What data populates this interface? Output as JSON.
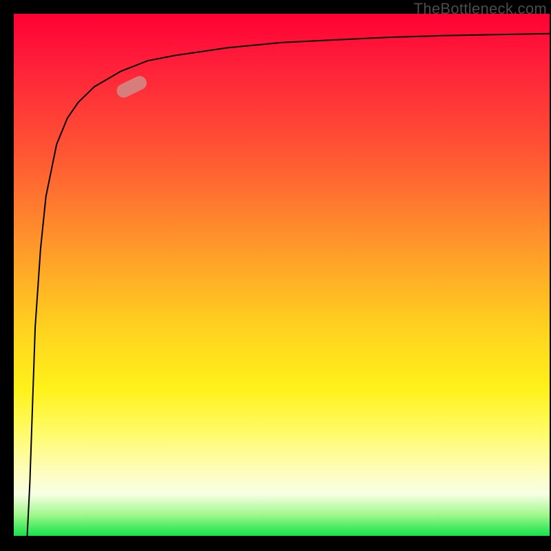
{
  "watermark": "TheBottleneck.com",
  "chart_data": {
    "type": "line",
    "title": "",
    "xlabel": "",
    "ylabel": "",
    "xlim": [
      0,
      100
    ],
    "ylim": [
      0,
      100
    ],
    "grid": false,
    "legend": false,
    "gradient_background": {
      "top_color": "#ff0033",
      "bottom_color": "#14e24a",
      "description": "vertical red-to-green gradient"
    },
    "series": [
      {
        "name": "curve",
        "x": [
          2.5,
          3,
          3.5,
          4,
          5,
          6,
          8,
          10,
          12,
          15,
          20,
          25,
          30,
          40,
          50,
          60,
          70,
          80,
          90,
          100
        ],
        "y": [
          0,
          10,
          25,
          40,
          55,
          65,
          75,
          80,
          83,
          86,
          89,
          91,
          92,
          93.5,
          94.5,
          95,
          95.5,
          95.8,
          96,
          96.2
        ]
      }
    ],
    "marker": {
      "description": "highlighted pill-shaped marker on curve",
      "approx_x": 22,
      "approx_y": 86,
      "color": "#d08c88"
    }
  }
}
